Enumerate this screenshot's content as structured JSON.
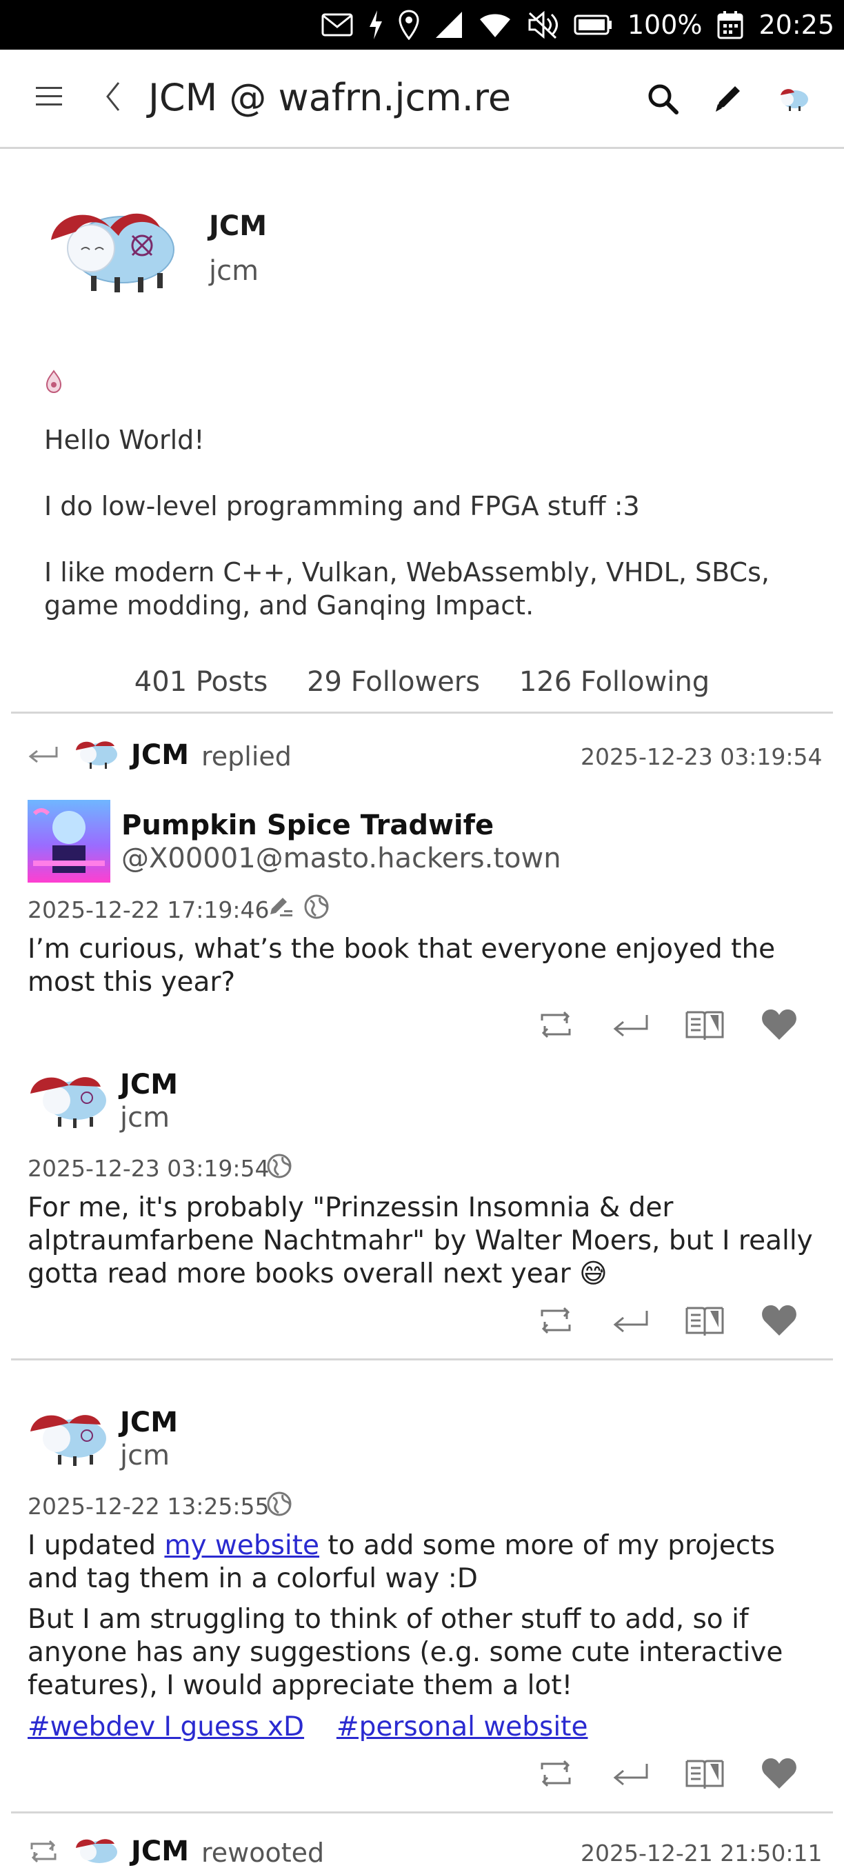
{
  "status_bar": {
    "battery": "100%",
    "time": "20:25",
    "icons": [
      "mail-icon",
      "flash-icon",
      "location-icon",
      "signal-icon",
      "wifi-icon",
      "mute-icon",
      "battery-icon",
      "calendar-icon"
    ]
  },
  "nav": {
    "title": "JCM @ wafrn.jcm.re",
    "icons": [
      "menu-icon",
      "back-icon",
      "search-icon",
      "pencil-icon",
      "avatar"
    ]
  },
  "profile": {
    "name": "JCM",
    "handle": "jcm",
    "bio": [
      "Hello World!",
      "I do low-level programming and FPGA stuff :3",
      "I like modern C++, Vulkan, WebAssembly, VHDL, SBCs, game modding, and Ganqing Impact."
    ],
    "stats": {
      "posts": "401 Posts",
      "followers": "29 Followers",
      "following": "126 Following"
    }
  },
  "posts": [
    {
      "header": {
        "author": "JCM",
        "action": "replied",
        "date": "2025-12-23 03:19:54"
      },
      "parent": {
        "name": "Pumpkin Spice Tradwife",
        "handle": "@X00001@masto.hackers.town",
        "date": "2025-12-22 17:19:46",
        "text": "I’m curious, what’s the book that everyone enjoyed the most this year?"
      },
      "reply": {
        "name": "JCM",
        "handle": "jcm",
        "date": "2025-12-23 03:19:54",
        "text": "For me, it's probably \"Prinzessin Insomnia & der alptraumfarbene Nachtmahr\" by Walter Moers, but I really gotta read more books overall next year 😅"
      }
    },
    {
      "name": "JCM",
      "handle": "jcm",
      "date": "2025-12-22 13:25:55",
      "text_before_link": "I updated ",
      "link_text": "my website",
      "text_after_link": " to add some more of my projects and tag them in a colorful way :D",
      "text2": "But I am struggling to think of other stuff to add, so if anyone has any suggestions (e.g. some cute interactive features), I would appreciate them a lot!",
      "tags": [
        "#webdev I guess xD",
        "#personal website"
      ]
    },
    {
      "header": {
        "author": "JCM",
        "action": "rewooted",
        "date": "2025-12-21 21:50:11"
      }
    }
  ],
  "colors": {
    "link": "#2a2ad0",
    "icon_gray": "#777777",
    "divider": "#d6d6d6"
  }
}
